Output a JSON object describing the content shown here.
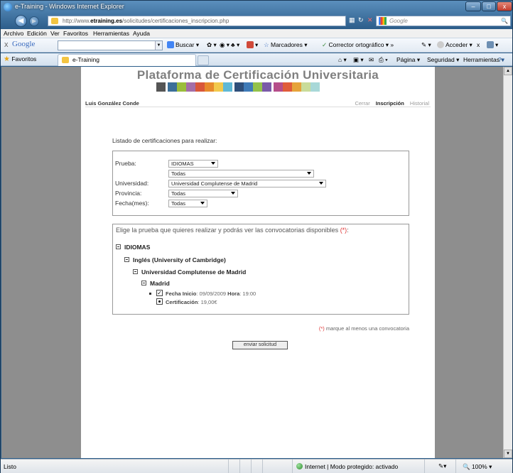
{
  "window": {
    "title": "e-Training - Windows Internet Explorer",
    "min_label": "–",
    "max_label": "□",
    "close_label": "x"
  },
  "address": {
    "prefix": "http://www.",
    "domain": "etraining.es",
    "path": "/solicitudes/certificaciones_inscripcion.php",
    "search_placeholder": "Google",
    "search_icon": "🔍"
  },
  "menu": [
    "Archivo",
    "Edición",
    "Ver",
    "Favoritos",
    "Herramientas",
    "Ayuda"
  ],
  "google_toolbar": {
    "logo": "Google",
    "buscar": "Buscar",
    "marcadores": "Marcadores",
    "corrector": "Corrector ortográfico",
    "acceder": "Acceder"
  },
  "tabs": {
    "favoritos": "Favoritos",
    "active_tab": "e-Training",
    "pagina": "Página",
    "seguridad": "Seguridad",
    "herramientas": "Herramientas"
  },
  "page": {
    "title": "Plataforma de Certificación Universitaria",
    "user": "Luis González Conde",
    "links": {
      "cerrar": "Cerrar",
      "inscripcion": "Inscripción",
      "historial": "Historial"
    },
    "list_title": "Listado de certificaciones para realizar:",
    "filters": {
      "prueba_label": "Prueba:",
      "prueba_value": "IDIOMAS",
      "sub_value": "Todas",
      "universidad_label": "Universidad:",
      "universidad_value": "Universidad Complutense de Madrid",
      "provincia_label": "Provincia:",
      "provincia_value": "Todas",
      "fecha_label": "Fecha(mes):",
      "fecha_value": "Todas"
    },
    "instructions": "Elige la prueba que quieres realizar y podrás ver las convocatorias disponibles ",
    "required_mark": "(*)",
    "required_mark_end": ":",
    "tree": {
      "level1": "IDIOMAS",
      "level2": "Inglés (University of Cambridge)",
      "level3": "Universidad Complutense de Madrid",
      "level4": "Madrid",
      "fecha_label": "Fecha Inicio",
      "fecha_value": ": 09/09/2009",
      "hora_label": "Hora",
      "hora_value": ": 19:00",
      "cert_label": "Certificación",
      "cert_value": ": 19,00€"
    },
    "note_mark": "(*)",
    "note": " marque al menos una convocatoria",
    "send_button": "enviar solicitud"
  },
  "status": {
    "text": "Listo",
    "zone": "Internet | Modo protegido: activado",
    "zoom": "100%"
  },
  "colors": {
    "banner": [
      "#555555",
      "#ffffff",
      "#3b6f99",
      "#9bbd3b",
      "#a46ea8",
      "#d9573a",
      "#e78a2c",
      "#f2c94c",
      "#5fb8d6",
      "#ffffff",
      "#2f4f7a",
      "#3f7bb8",
      "#93c24a",
      "#7a5aa8",
      "#ffffff",
      "#b54d8a",
      "#e05c3a",
      "#e6a33a",
      "#c9dc9a",
      "#a8d8d8"
    ]
  }
}
